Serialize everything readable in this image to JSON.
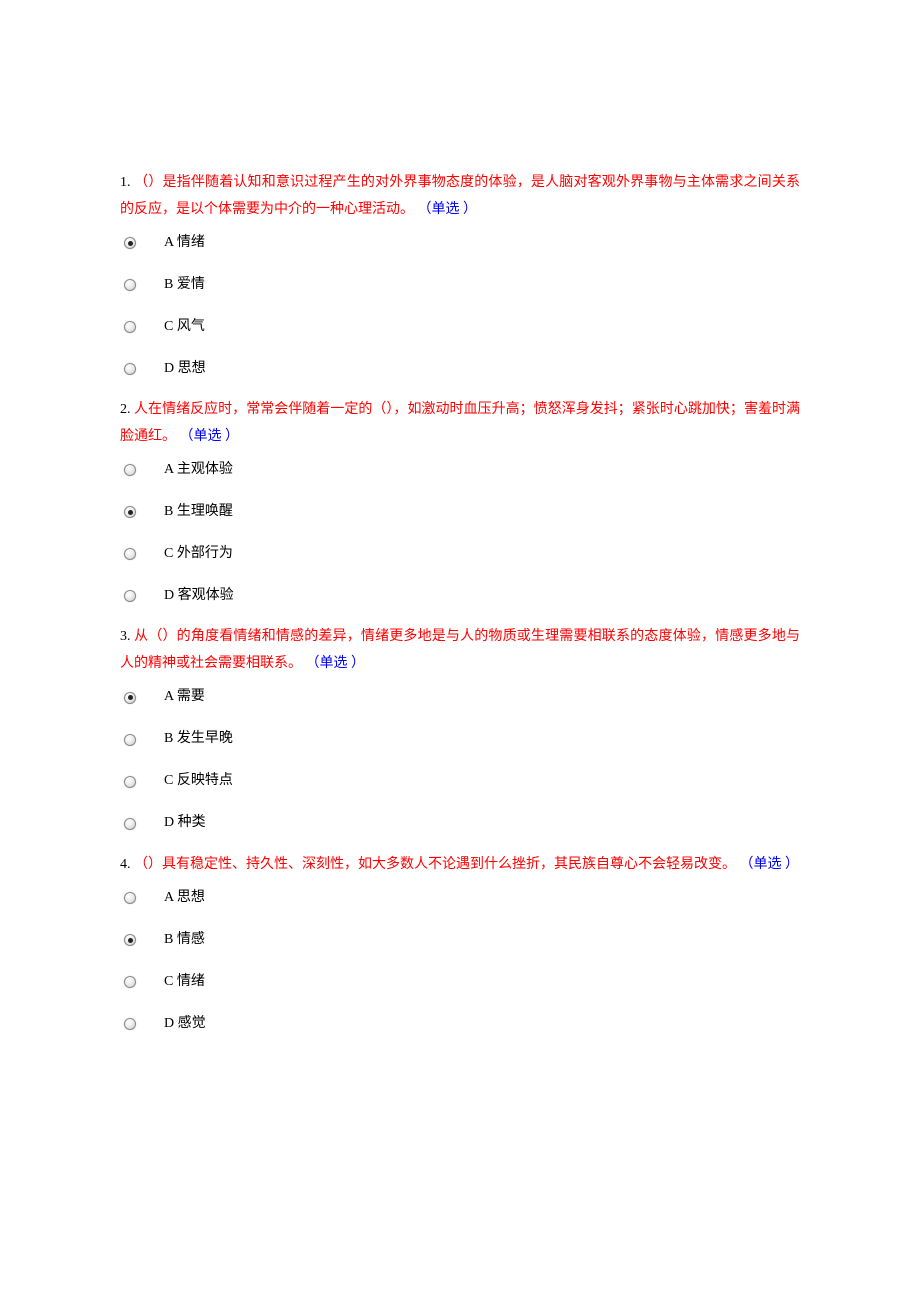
{
  "questions": [
    {
      "num": "1.",
      "text": "（）是指伴随着认知和意识过程产生的对外界事物态度的体验，是人脑对客观外界事物与主体需求之间关系的反应，是以个体需要为中介的一种心理活动。",
      "type": "（单选 ）",
      "selected": 0,
      "options": [
        {
          "label": "A 情绪"
        },
        {
          "label": "B 爱情"
        },
        {
          "label": "C 风气"
        },
        {
          "label": "D 思想"
        }
      ]
    },
    {
      "num": "2.",
      "text": "人在情绪反应时，常常会伴随着一定的（），如激动时血压升高；愤怒浑身发抖；紧张时心跳加快；害羞时满脸通红。",
      "type": "（单选 ）",
      "selected": 1,
      "options": [
        {
          "label": "A 主观体验"
        },
        {
          "label": "B 生理唤醒"
        },
        {
          "label": "C 外部行为"
        },
        {
          "label": "D 客观体验"
        }
      ]
    },
    {
      "num": "3.",
      "text": "从（）的角度看情绪和情感的差异，情绪更多地是与人的物质或生理需要相联系的态度体验，情感更多地与人的精神或社会需要相联系。",
      "type": "（单选 ）",
      "selected": 0,
      "options": [
        {
          "label": "A 需要"
        },
        {
          "label": "B 发生早晚"
        },
        {
          "label": "C 反映特点"
        },
        {
          "label": "D 种类"
        }
      ]
    },
    {
      "num": "4.",
      "text": "（）具有稳定性、持久性、深刻性，如大多数人不论遇到什么挫折，其民族自尊心不会轻易改变。",
      "type": "（单选 ）",
      "selected": 1,
      "options": [
        {
          "label": "A 思想"
        },
        {
          "label": "B 情感"
        },
        {
          "label": "C 情绪"
        },
        {
          "label": "D 感觉"
        }
      ]
    }
  ]
}
